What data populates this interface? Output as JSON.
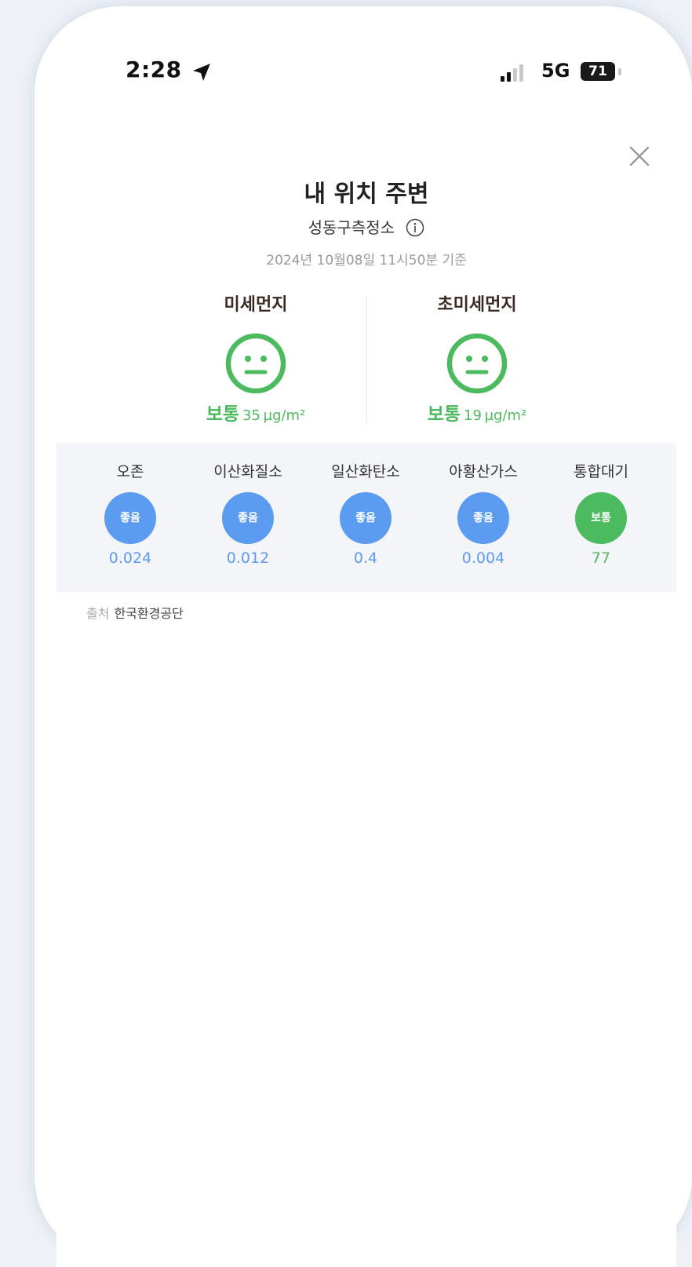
{
  "status_bar": {
    "time": "2:28",
    "network": "5G",
    "battery": "71"
  },
  "header": {
    "title": "내 위치 주변",
    "station": "성동구측정소",
    "timestamp": "2024년 10월08일 11시50분 기준"
  },
  "dust": [
    {
      "label": "미세먼지",
      "grade": "보통",
      "value": "35",
      "unit": "µg/m²"
    },
    {
      "label": "초미세먼지",
      "grade": "보통",
      "value": "19",
      "unit": "µg/m²"
    }
  ],
  "pollutants": [
    {
      "name": "오존",
      "grade": "좋음",
      "value": "0.024",
      "color": "#5b9cf0"
    },
    {
      "name": "이산화질소",
      "grade": "좋음",
      "value": "0.012",
      "color": "#5b9cf0"
    },
    {
      "name": "일산화탄소",
      "grade": "좋음",
      "value": "0.4",
      "color": "#5b9cf0"
    },
    {
      "name": "아황산가스",
      "grade": "좋음",
      "value": "0.004",
      "color": "#5b9cf0"
    },
    {
      "name": "통합대기",
      "grade": "보통",
      "value": "77",
      "color": "#4cbb5f"
    }
  ],
  "source": {
    "label": "출처",
    "name": "한국환경공단"
  },
  "colors": {
    "good": "#5b9cf0",
    "normal": "#4cbb5f",
    "band_background": "#f3f5f8"
  },
  "icons": {
    "close": "close-icon",
    "info": "info-icon",
    "face": "neutral-face-icon",
    "location": "location-arrow-icon"
  }
}
